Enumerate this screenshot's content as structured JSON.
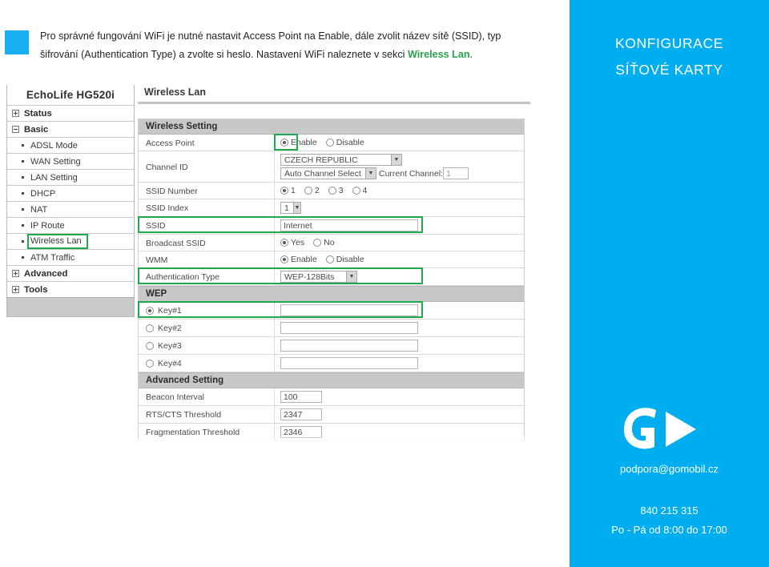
{
  "intro": {
    "text_part1": "Pro správné fungování WiFi  je nutné nastavit Access Point na Enable, dále zvolit název sítě (SSID), typ šifrování (Authentication Type) a zvolte si heslo. Nastavení WiFi naleznete v sekci ",
    "highlight": "Wireless Lan",
    "text_part2": "."
  },
  "router": {
    "brand": "EchoLife HG520i",
    "nav": [
      {
        "label": "Status",
        "level": 0,
        "marker": "plus",
        "selected": false
      },
      {
        "label": "Basic",
        "level": 0,
        "marker": "minus",
        "selected": false
      },
      {
        "label": "ADSL Mode",
        "level": 1,
        "marker": "bullet",
        "selected": false
      },
      {
        "label": "WAN Setting",
        "level": 1,
        "marker": "bullet",
        "selected": false
      },
      {
        "label": "LAN Setting",
        "level": 1,
        "marker": "bullet",
        "selected": false
      },
      {
        "label": "DHCP",
        "level": 1,
        "marker": "bullet",
        "selected": false
      },
      {
        "label": "NAT",
        "level": 1,
        "marker": "bullet",
        "selected": false
      },
      {
        "label": "IP Route",
        "level": 1,
        "marker": "bullet",
        "selected": false
      },
      {
        "label": "Wireless Lan",
        "level": 1,
        "marker": "bullet",
        "selected": true
      },
      {
        "label": "ATM Traffic",
        "level": 1,
        "marker": "bullet",
        "selected": false
      },
      {
        "label": "Advanced",
        "level": 0,
        "marker": "plus",
        "selected": false
      },
      {
        "label": "Tools",
        "level": 0,
        "marker": "plus",
        "selected": false
      }
    ],
    "page_title": "Wireless Lan",
    "sections": {
      "wireless_setting": "Wireless Setting",
      "wep": "WEP",
      "advanced_setting": "Advanced Setting"
    },
    "rows": {
      "access_point": {
        "label": "Access Point",
        "options": [
          {
            "label": "Enable",
            "selected": true
          },
          {
            "label": "Disable",
            "selected": false
          }
        ]
      },
      "channel_id": {
        "label": "Channel ID",
        "country": "CZECH REPUBLIC",
        "channel_mode": "Auto Channel Select",
        "current_channel_label": "Current Channel:",
        "current_channel_value": "1"
      },
      "ssid_number": {
        "label": "SSID Number",
        "options": [
          {
            "label": "1",
            "selected": true
          },
          {
            "label": "2",
            "selected": false
          },
          {
            "label": "3",
            "selected": false
          },
          {
            "label": "4",
            "selected": false
          }
        ]
      },
      "ssid_index": {
        "label": "SSID Index",
        "value": "1"
      },
      "ssid": {
        "label": "SSID",
        "value": "Internet"
      },
      "broadcast_ssid": {
        "label": "Broadcast SSID",
        "options": [
          {
            "label": "Yes",
            "selected": true
          },
          {
            "label": "No",
            "selected": false
          }
        ]
      },
      "wmm": {
        "label": "WMM",
        "options": [
          {
            "label": "Enable",
            "selected": true
          },
          {
            "label": "Disable",
            "selected": false
          }
        ]
      },
      "authentication_type": {
        "label": "Authentication Type",
        "value": "WEP-128Bits"
      },
      "keys": [
        {
          "label": "Key#1",
          "selected": true,
          "value": ""
        },
        {
          "label": "Key#2",
          "selected": false,
          "value": ""
        },
        {
          "label": "Key#3",
          "selected": false,
          "value": ""
        },
        {
          "label": "Key#4",
          "selected": false,
          "value": ""
        }
      ],
      "beacon_interval": {
        "label": "Beacon Interval",
        "value": "100"
      },
      "rts_cts_threshold": {
        "label": "RTS/CTS Threshold",
        "value": "2347"
      },
      "fragmentation_threshold": {
        "label": "Fragmentation Threshold",
        "value": "2346"
      }
    }
  },
  "panel": {
    "kicker_line1": "KONFIGURACE",
    "kicker_line2": "SÍŤOVÉ KARTY",
    "logo_letter": "G",
    "email": "podpora@gomobil.cz",
    "phone": "840 215 315",
    "hours": "Po - Pá od 8:00 do 17:00"
  },
  "colors": {
    "brand_blue": "#00AEEF",
    "swatch_blue": "#18b0ee",
    "highlight_green": "#1faa4e",
    "link_green": "#27a34b"
  }
}
